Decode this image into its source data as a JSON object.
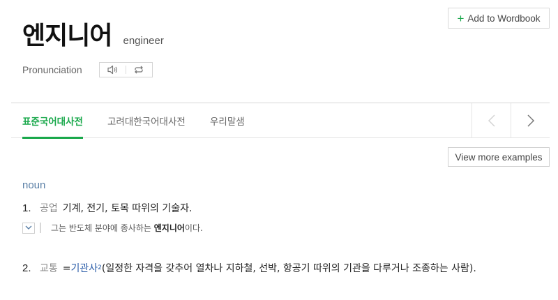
{
  "entry": {
    "headword": "엔지니어",
    "translation": "engineer"
  },
  "actions": {
    "add_to_wordbook": "Add to Wordbook",
    "add_icon": "plus-icon"
  },
  "pronunciation": {
    "label": "Pronunciation",
    "icons": [
      "speaker-icon",
      "repeat-icon"
    ]
  },
  "tabs": [
    {
      "label": "표준국어대사전",
      "active": true
    },
    {
      "label": "고려대한국어대사전",
      "active": false
    },
    {
      "label": "우리말샘",
      "active": false
    }
  ],
  "tab_nav": {
    "prev_icon": "chevron-left-icon",
    "next_icon": "chevron-right-icon"
  },
  "view_more_examples": "View more examples",
  "part_of_speech": "noun",
  "senses": [
    {
      "number": "1.",
      "field": "공업",
      "definition": "기계, 전기, 토목 따위의 기술자.",
      "example": {
        "before": "그는 반도체 분야에 종사하는 ",
        "highlight": "엔지니어",
        "after": "이다."
      }
    },
    {
      "number": "2.",
      "field": "교통",
      "equals": "=",
      "link": "기관사",
      "superscript": "2",
      "definition": "(일정한 자격을 갖추어 열차나 지하철, 선박, 항공기 따위의 기관을 다루거나 조종하는 사람)."
    }
  ],
  "colors": {
    "accent_green": "#19a84b",
    "link_blue": "#2a5ca8",
    "pos_blue": "#5a7fa6"
  }
}
